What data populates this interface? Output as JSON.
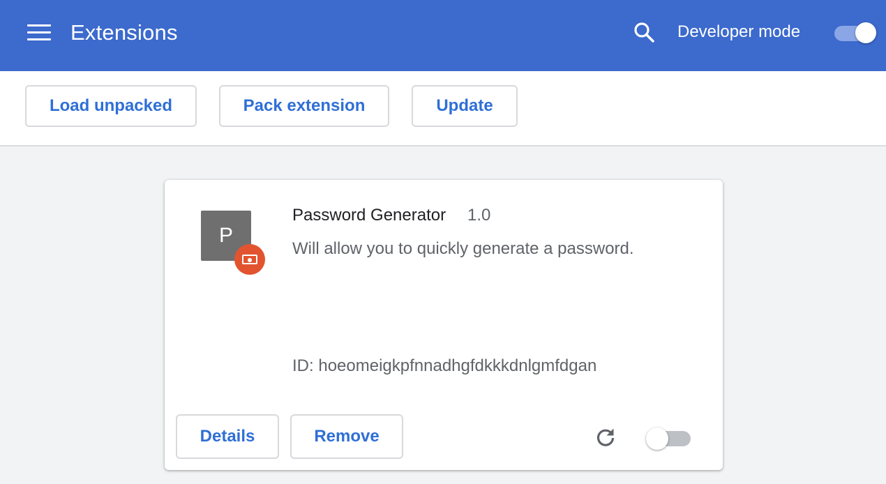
{
  "header": {
    "title": "Extensions",
    "menu_icon": "hamburger-menu-icon",
    "search_icon": "search-icon",
    "developer_mode_label": "Developer mode",
    "developer_mode_enabled": true,
    "bar_color": "#3c6acd"
  },
  "toolbar": {
    "load_unpacked_label": "Load unpacked",
    "pack_extension_label": "Pack extension",
    "update_label": "Update"
  },
  "extension": {
    "icon_letter": "P",
    "badge_icon": "unpacked-extension-badge-icon",
    "name": "Password Generator",
    "version": "1.0",
    "description": "Will allow you to quickly generate a password.",
    "id_label": "ID: ",
    "id": "hoeomeigkpfnnadhgfdkkkdnlgmfdgan",
    "details_label": "Details",
    "remove_label": "Remove",
    "reload_icon": "reload-icon",
    "enabled": false
  },
  "colors": {
    "accent": "#2f6fd6",
    "badge": "#e2542f"
  }
}
